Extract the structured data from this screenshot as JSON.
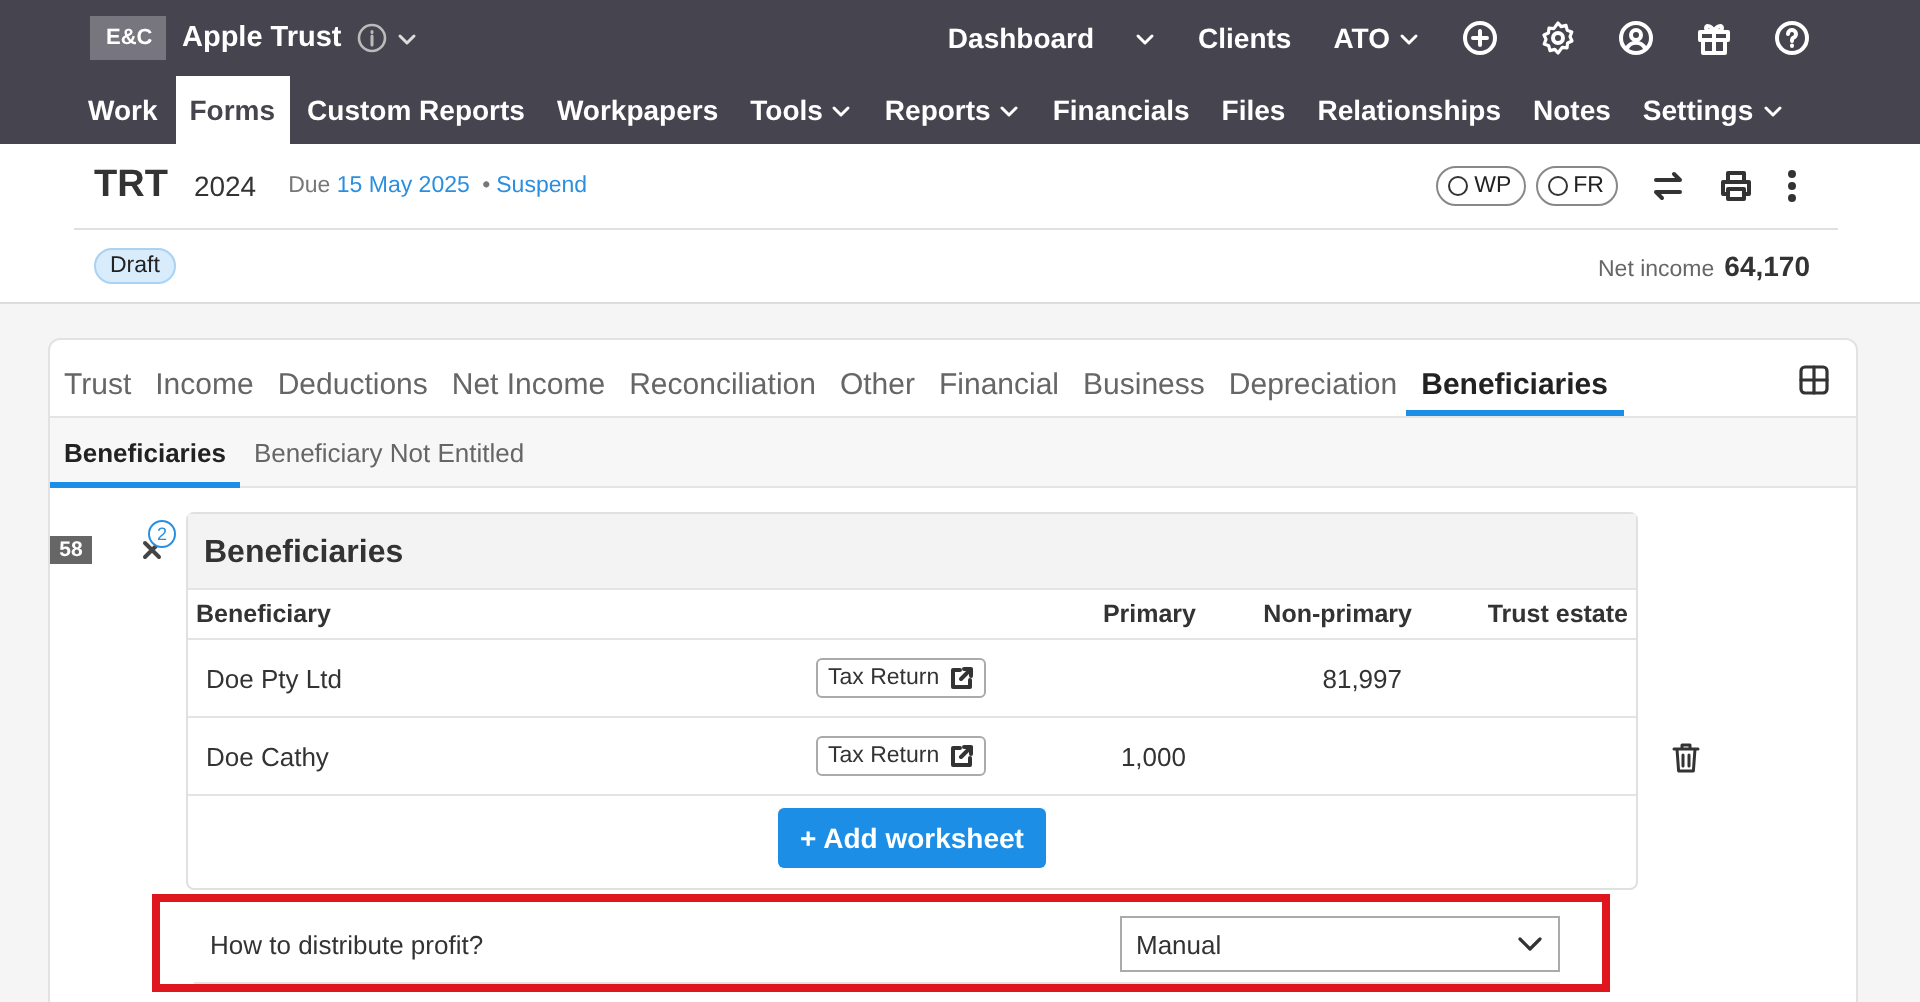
{
  "org": {
    "badge": "E&C",
    "name": "Apple Trust"
  },
  "top_links": [
    {
      "label": "Dashboard",
      "dropdown": true
    },
    {
      "label": "Clients",
      "dropdown": false
    },
    {
      "label": "ATO",
      "dropdown": true
    }
  ],
  "nav": [
    {
      "label": "Work",
      "selected": false,
      "dropdown": false
    },
    {
      "label": "Forms",
      "selected": true,
      "dropdown": false
    },
    {
      "label": "Custom Reports",
      "selected": false,
      "dropdown": false
    },
    {
      "label": "Workpapers",
      "selected": false,
      "dropdown": false
    },
    {
      "label": "Tools",
      "selected": false,
      "dropdown": true
    },
    {
      "label": "Reports",
      "selected": false,
      "dropdown": true
    },
    {
      "label": "Financials",
      "selected": false,
      "dropdown": false
    },
    {
      "label": "Files",
      "selected": false,
      "dropdown": false
    },
    {
      "label": "Relationships",
      "selected": false,
      "dropdown": false
    },
    {
      "label": "Notes",
      "selected": false,
      "dropdown": false
    },
    {
      "label": "Settings",
      "selected": false,
      "dropdown": true
    }
  ],
  "form": {
    "code": "TRT",
    "year": "2024",
    "due_label": "Due",
    "due_date": "15 May 2025",
    "separator": "•",
    "suspend": "Suspend",
    "status": "Draft",
    "net_income_label": "Net income",
    "net_income": "64,170",
    "toggles": [
      {
        "label": "WP",
        "checked": false
      },
      {
        "label": "FR",
        "checked": false
      }
    ]
  },
  "tabs": [
    {
      "label": "Trust",
      "selected": false
    },
    {
      "label": "Income",
      "selected": false
    },
    {
      "label": "Deductions",
      "selected": false
    },
    {
      "label": "Net Income",
      "selected": false
    },
    {
      "label": "Reconciliation",
      "selected": false
    },
    {
      "label": "Other",
      "selected": false
    },
    {
      "label": "Financial",
      "selected": false
    },
    {
      "label": "Business",
      "selected": false
    },
    {
      "label": "Depreciation",
      "selected": false
    },
    {
      "label": "Beneficiaries",
      "selected": true
    }
  ],
  "subtabs": [
    {
      "label": "Beneficiaries",
      "selected": true
    },
    {
      "label": "Beneficiary Not Entitled",
      "selected": false
    }
  ],
  "section": {
    "number": "58",
    "notice_count": "2",
    "title": "Beneficiaries",
    "columns": [
      "Beneficiary",
      "Primary",
      "Non-primary",
      "Trust estate"
    ],
    "rows": [
      {
        "name": "Doe Pty Ltd",
        "link": "Tax Return",
        "primary": "",
        "non_primary": "81,997",
        "trust_estate": "",
        "show_delete": false
      },
      {
        "name": "Doe Cathy",
        "link": "Tax Return",
        "primary": "1,000",
        "non_primary": "",
        "trust_estate": "",
        "show_delete": true
      }
    ],
    "add_button": "+ Add worksheet"
  },
  "distribution": {
    "question": "How to distribute profit?",
    "value": "Manual",
    "highlighted": true
  }
}
